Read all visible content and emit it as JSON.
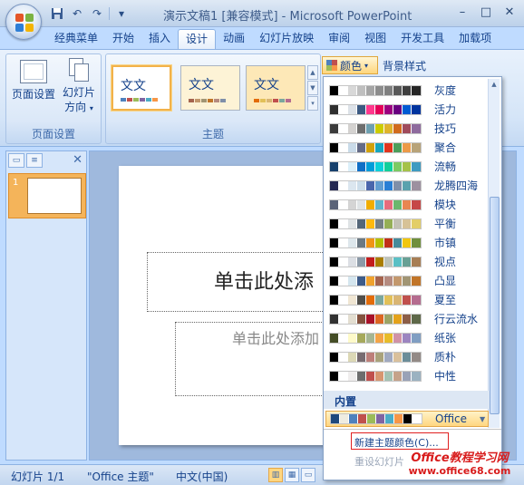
{
  "window": {
    "title": "演示文稿1 [兼容模式] - Microsoft PowerPoint",
    "controls": {
      "minimize": "–",
      "maximize": "□",
      "close": "✕"
    }
  },
  "quick_access": {
    "save_icon": "save-icon",
    "undo_icon": "undo-icon",
    "redo_icon": "redo-icon",
    "customize": "▾"
  },
  "tabs": [
    "经典菜单",
    "开始",
    "插入",
    "设计",
    "动画",
    "幻灯片放映",
    "审阅",
    "视图",
    "开发工具",
    "加载项"
  ],
  "active_tab": "设计",
  "ribbon": {
    "page_setup_group": {
      "label": "页面设置",
      "page_setup_btn": "页面设置",
      "orientation_btn_line1": "幻灯片",
      "orientation_btn_line2": "方向"
    },
    "themes_group": {
      "label": "主题",
      "themes": [
        {
          "text": "文文",
          "selected": true,
          "bg": "#ffffff"
        },
        {
          "text": "文文",
          "selected": false,
          "bg": "#fdf3d6"
        },
        {
          "text": "文文",
          "selected": false,
          "bg": "#fde8b7"
        }
      ]
    },
    "colors_btn": "颜色",
    "background_style_btn": "背景样式"
  },
  "color_schemes": [
    {
      "name": "灰度",
      "colors": [
        "#000000",
        "#ffffff",
        "#d8d8d8",
        "#bfbfbf",
        "#a5a5a5",
        "#8c8c8c",
        "#7f7f7f",
        "#595959",
        "#3f3f3f",
        "#262626"
      ]
    },
    {
      "name": "活力",
      "colors": [
        "#2f2f2f",
        "#ffffff",
        "#dde2e8",
        "#3c5a82",
        "#ff388c",
        "#e40059",
        "#9c007f",
        "#68007f",
        "#005bd3",
        "#00349e"
      ]
    },
    {
      "name": "技巧",
      "colors": [
        "#3b3b3b",
        "#ffffff",
        "#d4d2d0",
        "#6e6e6e",
        "#6ea0b0",
        "#cccc00",
        "#dfb32c",
        "#d16b1e",
        "#a04b5c",
        "#8f6b9e"
      ]
    },
    {
      "name": "聚合",
      "colors": [
        "#000000",
        "#ffffff",
        "#cadbe9",
        "#646b86",
        "#d1a10b",
        "#16a5be",
        "#e0351f",
        "#4d9e5b",
        "#ec9a48",
        "#b8a379"
      ]
    },
    {
      "name": "流畅",
      "colors": [
        "#17406d",
        "#ffffff",
        "#dbeff9",
        "#0f6fc6",
        "#009dd9",
        "#0bd0d9",
        "#10cf9b",
        "#7cca62",
        "#a5c249",
        "#3e9bc1"
      ]
    },
    {
      "name": "龙腾四海",
      "colors": [
        "#242852",
        "#ffffff",
        "#dbe6ef",
        "#ccddea",
        "#4a66ac",
        "#629dd1",
        "#297fd5",
        "#7f8fa9",
        "#5aa2ae",
        "#9d90a0"
      ]
    },
    {
      "name": "模块",
      "colors": [
        "#5a6378",
        "#ffffff",
        "#d4d4d4",
        "#dfe3e5",
        "#f0ad00",
        "#60b5cc",
        "#e66c7d",
        "#6bb76d",
        "#e88651",
        "#c64847"
      ]
    },
    {
      "name": "平衡",
      "colors": [
        "#000000",
        "#ffffff",
        "#dfe3e5",
        "#546779",
        "#ffb90d",
        "#758085",
        "#95af56",
        "#c3c1b4",
        "#d7c297",
        "#e3ce67"
      ]
    },
    {
      "name": "市镇",
      "colors": [
        "#000000",
        "#ffffff",
        "#dee7ec",
        "#6c7983",
        "#f09415",
        "#b4bf00",
        "#c13018",
        "#478b9a",
        "#f1c60e",
        "#708f3d"
      ]
    },
    {
      "name": "视点",
      "colors": [
        "#000000",
        "#ffffff",
        "#dcdfe4",
        "#8c9aa8",
        "#c31c1d",
        "#aa7e00",
        "#bdc3b9",
        "#5ac0c5",
        "#68a095",
        "#a77e55"
      ]
    },
    {
      "name": "凸显",
      "colors": [
        "#000000",
        "#ffffff",
        "#d5e6ef",
        "#3e5c8a",
        "#f0a22e",
        "#a5644e",
        "#b58b80",
        "#c3986d",
        "#a19574",
        "#c17529"
      ]
    },
    {
      "name": "夏至",
      "colors": [
        "#000000",
        "#ffffff",
        "#f0e6d3",
        "#514f4b",
        "#e36c09",
        "#7ba79d",
        "#e2c058",
        "#d9b573",
        "#c0504d",
        "#b56c8f"
      ]
    },
    {
      "name": "行云流水",
      "colors": [
        "#323232",
        "#ffffff",
        "#e3ded1",
        "#84523f",
        "#a9122a",
        "#dc6723",
        "#9ca465",
        "#e4a21b",
        "#8c5e48",
        "#5e6849"
      ]
    },
    {
      "name": "纸张",
      "colors": [
        "#444d26",
        "#ffffff",
        "#fefac9",
        "#a6a95c",
        "#a5b592",
        "#f3a447",
        "#e7bc29",
        "#d092a7",
        "#9c85c0",
        "#809ec2"
      ]
    },
    {
      "name": "质朴",
      "colors": [
        "#000000",
        "#ffffff",
        "#dcd8b6",
        "#786c71",
        "#bd7f7a",
        "#a9a27b",
        "#a0a9c0",
        "#d9c09c",
        "#6b8d99",
        "#938a86"
      ]
    },
    {
      "name": "中性",
      "colors": [
        "#000000",
        "#ffffff",
        "#efeded",
        "#6d6d6d",
        "#c0504d",
        "#d79670",
        "#a4c2b2",
        "#c5a289",
        "#99a2b7",
        "#9bb2c1"
      ]
    }
  ],
  "builtin_label": "内置",
  "office_scheme": {
    "name": "Office",
    "colors": [
      "#1f497d",
      "#eeece1",
      "#4f81bd",
      "#c0504d",
      "#9bbb59",
      "#8064a2",
      "#4bacc6",
      "#f79646",
      "#000000",
      "#ffffff"
    ]
  },
  "menu": {
    "new_theme_colors": "新建主题颜色(C)...",
    "reset_colors": "重设幻灯片"
  },
  "slide": {
    "title_placeholder": "单击此处添",
    "subtitle_placeholder": "单击此处添加"
  },
  "slide_panel": {
    "slide_number": "1"
  },
  "statusbar": {
    "slide_info": "幻灯片 1/1",
    "theme_info": "\"Office 主题\"",
    "language": "中文(中国)"
  },
  "watermark": {
    "line1": "Office教程学习网",
    "line2": "www.office68.com"
  }
}
